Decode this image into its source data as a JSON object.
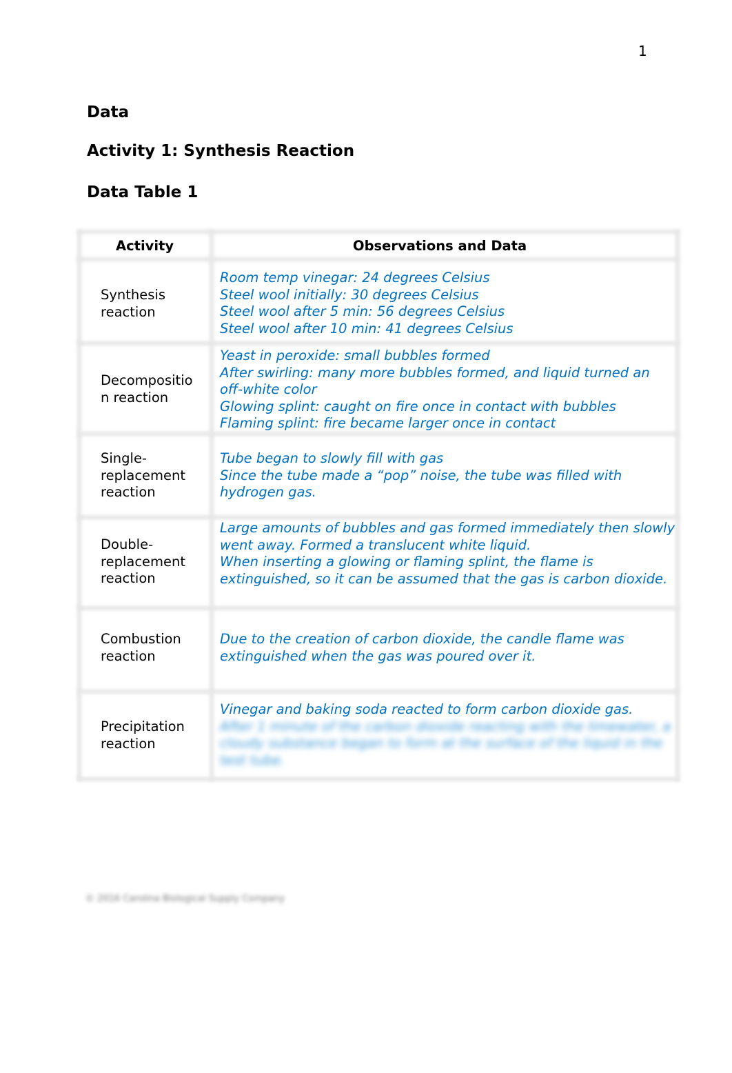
{
  "page_number": "1",
  "headings": {
    "section": "Data",
    "activity": "Activity 1: Synthesis Reaction",
    "table_title": "Data Table 1"
  },
  "table": {
    "columns": [
      "Activity",
      "Observations and Data"
    ],
    "rows": [
      {
        "activity": "Synthesis reaction",
        "observations": [
          "Room temp vinegar: 24 degrees Celsius",
          "Steel wool initially: 30 degrees Celsius",
          "Steel wool after 5 min: 56 degrees Celsius",
          "Steel wool after 10 min: 41 degrees Celsius"
        ]
      },
      {
        "activity": "Decompositio n reaction",
        "observations": [
          "Yeast in peroxide: small bubbles formed",
          "After swirling: many more bubbles formed, and liquid turned an off-white color",
          "Glowing splint: caught on fire once in contact with bubbles",
          "Flaming splint: fire became larger once in contact"
        ]
      },
      {
        "activity": "Single-replacement reaction",
        "observations": [
          "Tube began to slowly fill with gas",
          "Since the tube made a “pop” noise, the tube was filled with hydrogen gas."
        ]
      },
      {
        "activity": "Double-replacement reaction",
        "observations": [
          "Large amounts of bubbles and gas formed immediately then slowly went away. Formed a translucent white liquid.",
          "When inserting a glowing or flaming splint, the flame is extinguished, so it can be assumed that the gas is carbon dioxide."
        ]
      },
      {
        "activity": "Combustion reaction",
        "observations": [
          "Due to the creation of carbon dioxide, the candle flame was extinguished when the gas was poured over it."
        ]
      },
      {
        "activity": "Precipitation reaction",
        "observations": [
          "Vinegar and baking soda reacted to form carbon dioxide gas.",
          "After 1 minute of the carbon dioxide reacting with the limewater, a cloudy substance began to form at the surface of the liquid in the test tube."
        ]
      }
    ]
  },
  "colors": {
    "observation_text": "#0070c0",
    "grid": "#e6e6e6"
  },
  "footer": "© 2016 Carolina Biological Supply Company"
}
